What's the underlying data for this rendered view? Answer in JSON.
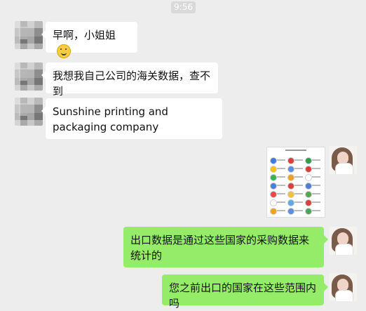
{
  "status": {
    "time": "9:56"
  },
  "messages": [
    {
      "text": "早啊，小姐姐"
    },
    {
      "text": "我想我自己公司的海关数据，查不到"
    },
    {
      "text": " Sunshine printing and packaging company"
    },
    {
      "text": "出口数据是通过这些国家的采购数据来统计的"
    },
    {
      "text": "您之前出口的国家在这些范围内吗"
    }
  ],
  "colors": {
    "background": "#ededed",
    "outgoing_bubble": "#95ec69",
    "incoming_bubble": "#ffffff"
  },
  "icons": {
    "emoji": "smiling-face-icon"
  }
}
